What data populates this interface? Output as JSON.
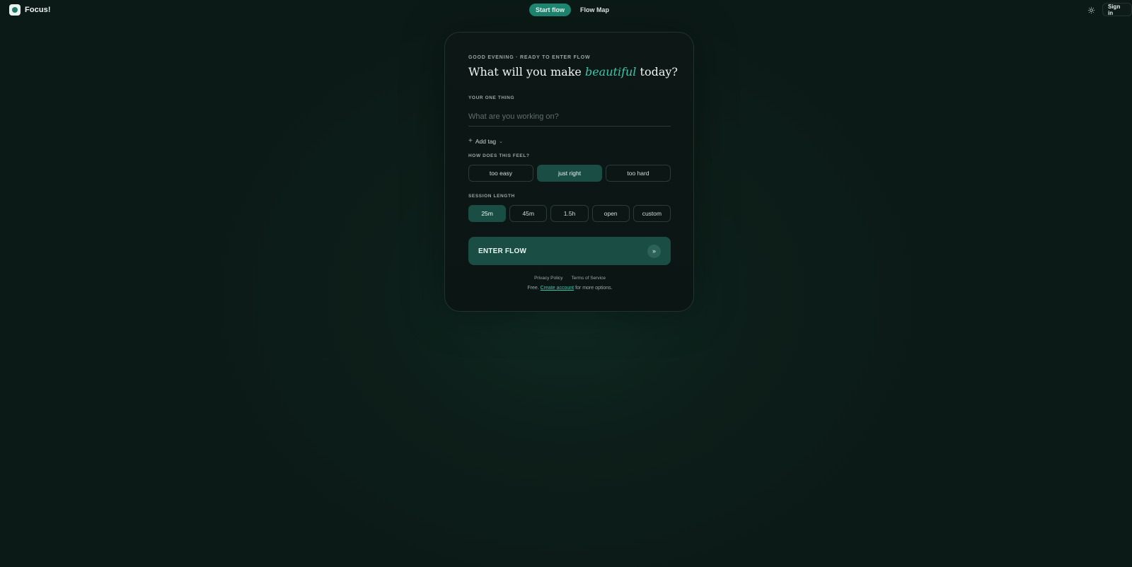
{
  "app": {
    "name": "Focus!"
  },
  "nav": {
    "start_flow": "Start flow",
    "flow_map": "Flow Map"
  },
  "header": {
    "sign_in": "Sign in",
    "theme_icon": "sun-icon"
  },
  "card": {
    "eyebrow": "GOOD EVENING · READY TO ENTER FLOW",
    "headline_before": "What will you make",
    "headline_accent": "beautiful",
    "headline_after": "today?",
    "one_thing_label": "YOUR ONE THING",
    "task_placeholder": "What are you working on?",
    "task_value": "",
    "add_tag": "Add tag",
    "feel_label": "HOW DOES THIS FEEL?",
    "feel_options": [
      "too easy",
      "just right",
      "too hard"
    ],
    "feel_selected": "just right",
    "length_label": "SESSION LENGTH",
    "length_options": [
      "25m",
      "45m",
      "1.5h",
      "open",
      "custom"
    ],
    "length_selected": "25m",
    "enter_label": "ENTER FLOW",
    "privacy": "Privacy Policy",
    "terms": "Terms of Service",
    "footnote_before": "Free.",
    "footnote_link": "Create account",
    "footnote_after": "for more options."
  },
  "colors": {
    "accent": "#3cc7ab",
    "button": "#1f8a75",
    "selected": "#1a4e44",
    "background": "#0c1a17"
  }
}
